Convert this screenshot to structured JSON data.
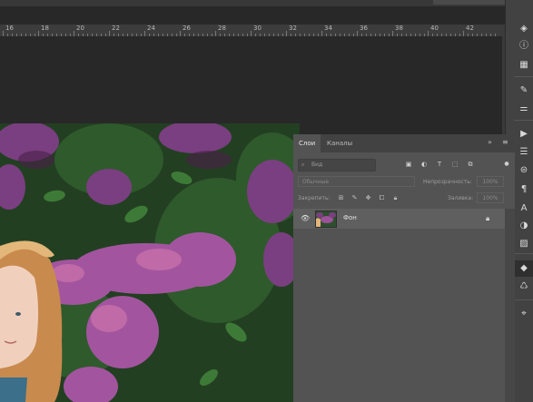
{
  "ruler": {
    "marks": [
      "16",
      "18",
      "20",
      "22",
      "24",
      "26",
      "28",
      "30",
      "32",
      "34",
      "36",
      "38",
      "40",
      "42"
    ]
  },
  "layers_panel": {
    "tabs": [
      {
        "label": "Слои"
      },
      {
        "label": "Каналы"
      }
    ],
    "menu_glyph": "≡",
    "collapse_glyph": "»",
    "search": {
      "placeholder": "Вид"
    },
    "blend_mode": "Обычные",
    "opacity": {
      "label": "Непрозрачность:",
      "value": "100%"
    },
    "lock": {
      "label": "Закрепить:"
    },
    "fill": {
      "label": "Заливка:",
      "value": "100%"
    },
    "layers": [
      {
        "name": "Фон",
        "visible": true,
        "locked": true
      }
    ]
  },
  "right_toolbar": {
    "icons": [
      "layers-stack-icon",
      "info-icon",
      "grid-icon",
      "brush-tool-icon",
      "sliders-icon",
      "play-icon",
      "list-icon",
      "adjust-icon",
      "paragraph-icon",
      "character-icon",
      "color-circle-icon",
      "image-icon",
      "layers-panel-icon",
      "color-swatch-icon",
      "path-icon"
    ]
  },
  "colors": {
    "accent": "#535353",
    "panel_dark": "#424242",
    "canvas": "#282828"
  }
}
